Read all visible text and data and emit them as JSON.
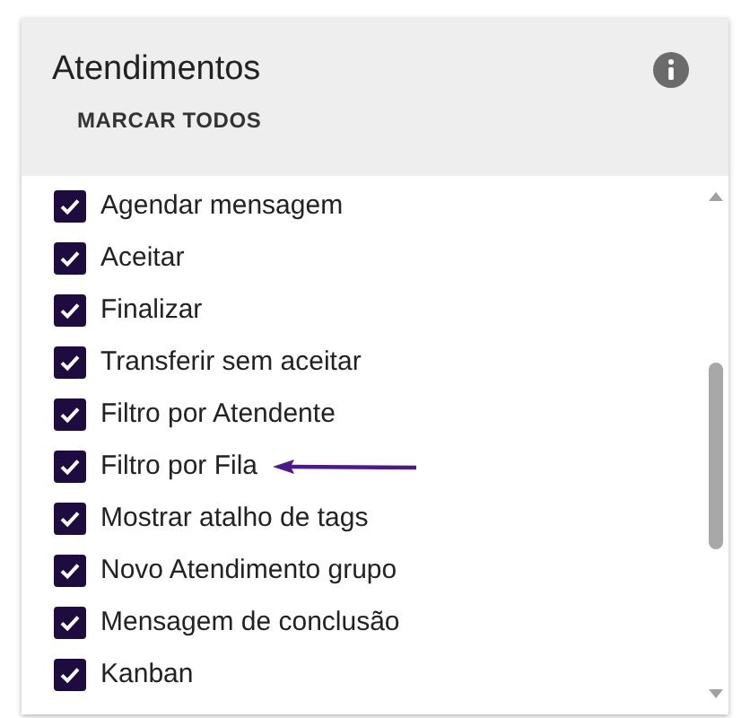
{
  "card": {
    "title": "Atendimentos",
    "mark_all_button": "MARCAR TODOS"
  },
  "options": [
    {
      "label": "Agendar mensagem",
      "checked": true,
      "arrow": false
    },
    {
      "label": "Aceitar",
      "checked": true,
      "arrow": false
    },
    {
      "label": "Finalizar",
      "checked": true,
      "arrow": false
    },
    {
      "label": "Transferir sem aceitar",
      "checked": true,
      "arrow": false
    },
    {
      "label": "Filtro por Atendente",
      "checked": true,
      "arrow": false
    },
    {
      "label": "Filtro por Fila",
      "checked": true,
      "arrow": true
    },
    {
      "label": "Mostrar atalho de tags",
      "checked": true,
      "arrow": false
    },
    {
      "label": "Novo Atendimento grupo",
      "checked": true,
      "arrow": false
    },
    {
      "label": "Mensagem de conclusão",
      "checked": true,
      "arrow": false
    },
    {
      "label": "Kanban",
      "checked": true,
      "arrow": false
    }
  ]
}
